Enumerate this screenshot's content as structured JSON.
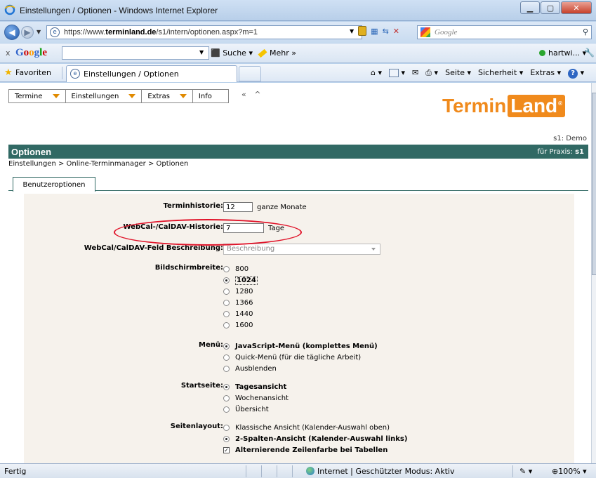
{
  "window": {
    "title": "Einstellungen / Optionen - Windows Internet Explorer"
  },
  "address": {
    "url_prefix": "https://www.",
    "url_domain": "terminland.de",
    "url_path": "/s1/intern/optionen.aspx?m=1",
    "search_placeholder": "Google"
  },
  "google_toolbar": {
    "close": "x",
    "suche": "Suche",
    "mehr": "Mehr »",
    "user": "hartwi...",
    "logo": [
      "G",
      "o",
      "o",
      "g",
      "l",
      "e"
    ]
  },
  "favorites_bar": {
    "favoriten": "Favoriten",
    "tab_title": "Einstellungen / Optionen",
    "seite": "Seite",
    "sicherheit": "Sicherheit",
    "extras": "Extras"
  },
  "app": {
    "menu": [
      {
        "label": "Termine"
      },
      {
        "label": "Einstellungen"
      },
      {
        "label": "Extras"
      },
      {
        "label": "Info"
      }
    ],
    "menu_collapse": "« ^",
    "logo_part1": "Termin",
    "logo_part2": "Land",
    "logo_reg": "®",
    "practice_id": "s1: Demo",
    "page_title": "Optionen",
    "praxis_label": "für Praxis:",
    "praxis_value": "s1",
    "breadcrumb": "Einstellungen > Online-Terminmanager > Optionen",
    "tab": "Benutzeroptionen"
  },
  "form": {
    "terminhistorie": {
      "label": "Terminhistorie:",
      "value": "12",
      "unit": "ganze Monate"
    },
    "webcal_historie": {
      "label": "WebCal-/CalDAV-Historie:",
      "value": "7",
      "unit": "Tage"
    },
    "webcal_feld": {
      "label": "WebCal/CalDAV-Feld Beschreibung:",
      "value": "Beschreibung"
    },
    "bildschirmbreite": {
      "label": "Bildschirmbreite:",
      "options": [
        "800",
        "1024",
        "1280",
        "1366",
        "1440",
        "1600"
      ],
      "selected": "1024"
    },
    "menu": {
      "label": "Menü:",
      "options": [
        "JavaScript-Menü (komplettes Menü)",
        "Quick-Menü (für die tägliche Arbeit)",
        "Ausblenden"
      ],
      "selected": "JavaScript-Menü (komplettes Menü)"
    },
    "startseite": {
      "label": "Startseite:",
      "options": [
        "Tagesansicht",
        "Wochenansicht",
        "Übersicht"
      ],
      "selected": "Tagesansicht"
    },
    "seitenlayout": {
      "label": "Seitenlayout:",
      "options": [
        "Klassische Ansicht (Kalender-Auswahl oben)",
        "2-Spalten-Ansicht (Kalender-Auswahl links)"
      ],
      "selected": "2-Spalten-Ansicht (Kalender-Auswahl links)",
      "checkbox_label": "Alternierende Zeilenfarbe bei Tabellen",
      "checkbox_checked": "✓"
    }
  },
  "status": {
    "left": "Fertig",
    "zone": "Internet | Geschützter Modus: Aktiv",
    "zoom": "100%"
  },
  "colors": {
    "accent_teal": "#316964",
    "logo_orange": "#f08a1c",
    "highlight_red": "#e0142a"
  }
}
